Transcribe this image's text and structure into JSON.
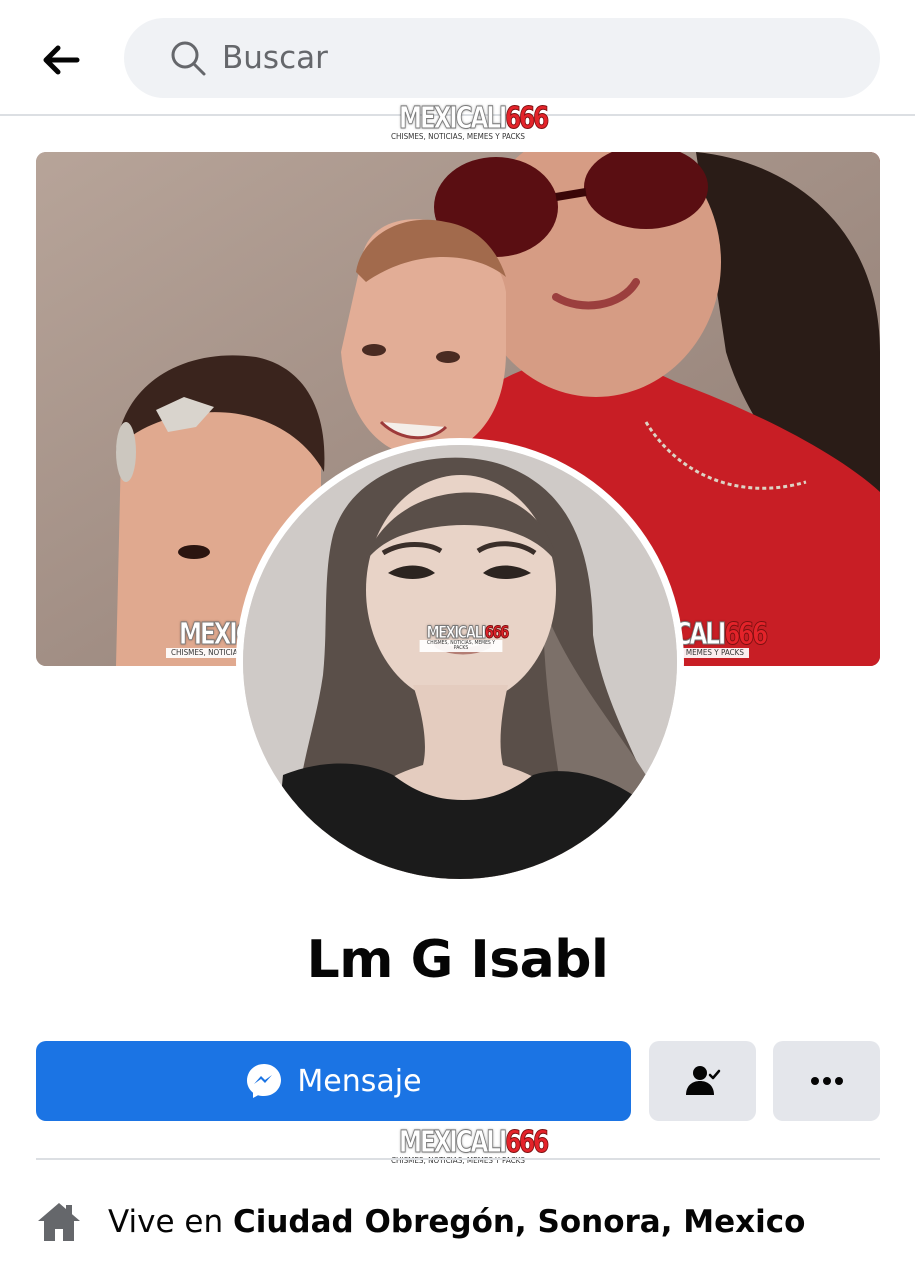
{
  "header": {
    "back_icon": "arrow-left-icon",
    "search_placeholder": "Buscar",
    "search_icon": "search-icon"
  },
  "watermark": {
    "brand_a": "MEXICALI",
    "brand_b": "666",
    "tagline": "CHISMES, NOTICIAS, MEMES Y PACKS"
  },
  "profile": {
    "name": "Lm G Isabl",
    "cover_photo": "cover-photo",
    "profile_photo": "profile-photo"
  },
  "actions": {
    "message_label": "Mensaje",
    "message_icon": "messenger-icon",
    "friend_icon": "friend-check-icon",
    "more_icon": "more-dots-icon",
    "primary_color": "#1b74e4",
    "secondary_color": "#e4e6eb"
  },
  "intro": {
    "home_icon": "home-icon",
    "lives_prefix": "Vive en ",
    "lives_place": "Ciudad Obregón, Sonora, Mexico"
  }
}
